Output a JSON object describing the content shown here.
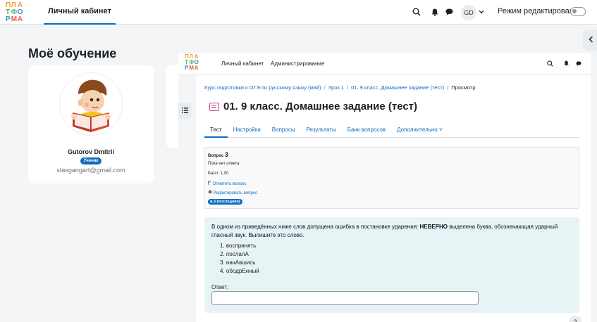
{
  "topbar": {
    "logo": [
      "П",
      "Л",
      "А",
      "Т",
      "Ф",
      "О",
      "Р",
      "М",
      "А"
    ],
    "nav_label": "Личный кабинет",
    "avatar_initials": "GD",
    "edit_mode_label": "Режим редактирования"
  },
  "page": {
    "title": "Моё обучение",
    "profile": {
      "name": "Gutorov Dmitrii",
      "role": "Ученик",
      "email": "stasgangart@gmail.com"
    }
  },
  "overlay": {
    "nav": {
      "links": [
        "Личный кабинет",
        "Администрирование"
      ]
    },
    "breadcrumb": [
      "Курс подготовки к ОГЭ по русскому языку (май)",
      "Урок 1",
      "01. 9 класс. Домашнее задание (тест)",
      "Просмотр"
    ],
    "title": "01. 9 класс. Домашнее задание (тест)",
    "tabs": [
      "Тест",
      "Настройки",
      "Вопросы",
      "Результаты",
      "Банк вопросов",
      "Дополнительно ˅"
    ],
    "question_info": {
      "label": "Вопрос",
      "number": "3",
      "status": "Пока нет ответа",
      "score": "Балл: 1,00",
      "flag_label": "Отметить вопрос",
      "edit_label": "Редактировать вопрос",
      "version_badge": "в.3 (последняя)"
    },
    "question": {
      "text_before": "В одном из приведённых ниже слов допущена ошибка в постановке ударения: ",
      "text_bold": "НЕВЕРНО",
      "text_after": " выделена буква, обозначающая ударный гласный звук. Выпишите это слово.",
      "options": [
        "1. воспринять",
        "2. послалА",
        "3. начАвшись",
        "4. ободрЕнный"
      ],
      "answer_label": "Ответ:"
    }
  },
  "help_label": "?"
}
